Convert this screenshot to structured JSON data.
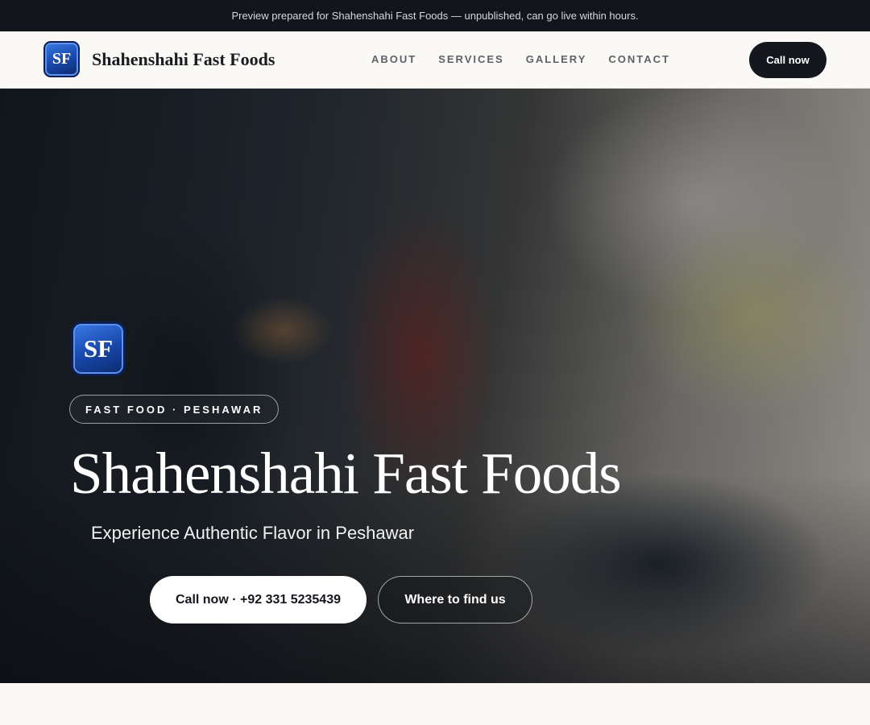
{
  "preview_banner": "Preview prepared for Shahenshahi Fast Foods — unpublished, can go live within hours.",
  "brand": {
    "initials": "SF",
    "name": "Shahenshahi Fast Foods"
  },
  "nav": {
    "items": [
      {
        "label": "ABOUT"
      },
      {
        "label": "SERVICES"
      },
      {
        "label": "GALLERY"
      },
      {
        "label": "CONTACT"
      }
    ],
    "cta_label": "Call now"
  },
  "hero": {
    "logo_initials": "SF",
    "tag": "FAST FOOD · PESHAWAR",
    "title": "Shahenshahi Fast Foods",
    "subtitle": "Experience Authentic Flavor in Peshawar",
    "primary_button": "Call now · +92 331 5235439",
    "secondary_button": "Where to find us"
  },
  "colors": {
    "brand_blue": "#1746a8",
    "dark": "#14171d",
    "banner_bg": "#12151b",
    "page_bg": "#f9f8f5"
  }
}
